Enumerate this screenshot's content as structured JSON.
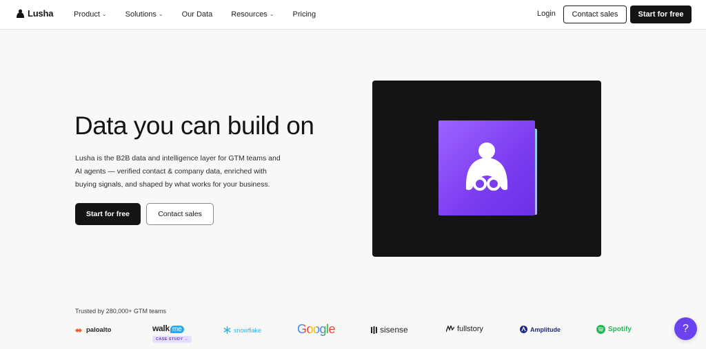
{
  "nav": {
    "logo_text": "Lusha",
    "items": [
      {
        "label": "Product",
        "has_dropdown": true
      },
      {
        "label": "Solutions",
        "has_dropdown": true
      },
      {
        "label": "Our Data",
        "has_dropdown": false
      },
      {
        "label": "Resources",
        "has_dropdown": true
      },
      {
        "label": "Pricing",
        "has_dropdown": false
      }
    ],
    "chevron": "⌄",
    "login_label": "Login",
    "contact_label": "Contact sales",
    "start_label": "Start for free"
  },
  "hero": {
    "title": "Data you can build on",
    "description": "Lusha is the B2B data and intelligence layer for GTM teams and AI agents — verified contact & company data, enriched with buying signals, and shaped by what works for your business.",
    "primary_label": "Start for free",
    "secondary_label": "Contact sales"
  },
  "trusted": {
    "text": "Trusted by 280,000+ GTM teams",
    "logos": {
      "paloalto": "paloalto",
      "walkme_walk": "walk",
      "walkme_me": "me",
      "case_study": "CASE STUDY →",
      "snowflake": "snowflake",
      "google": "Google",
      "sisense": "sisense",
      "fullstory": "fullstory",
      "amplitude": "Amplitude",
      "spotify": "Spotify"
    }
  },
  "help_label": "?",
  "colors": {
    "brand_purple": "#7b3cf0",
    "dark": "#141414",
    "help_bubble": "#6b42f0"
  }
}
